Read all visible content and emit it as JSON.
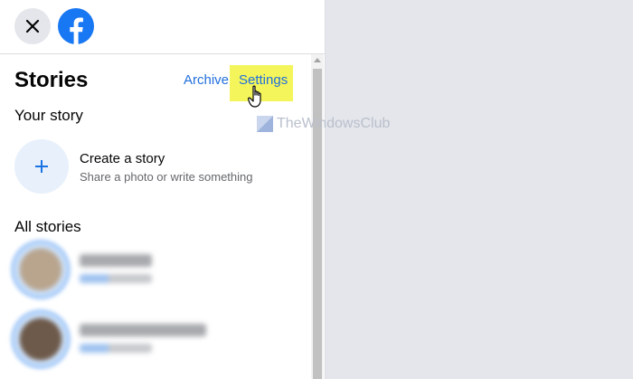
{
  "header": {
    "close_icon": "close-icon",
    "logo_icon": "facebook-logo-icon",
    "brand_color": "#1877f2"
  },
  "stories": {
    "title": "Stories",
    "archive_label": "Archive",
    "separator": "·",
    "settings_label": "Settings",
    "link_color": "#216fdb",
    "highlight_color": "#f4f55a"
  },
  "your_story": {
    "heading": "Your story",
    "create_title": "Create a story",
    "create_subtitle": "Share a photo or write something",
    "plus_icon": "plus-icon"
  },
  "all_stories": {
    "heading": "All stories"
  },
  "watermark": {
    "text": "TheWindowsClub"
  }
}
